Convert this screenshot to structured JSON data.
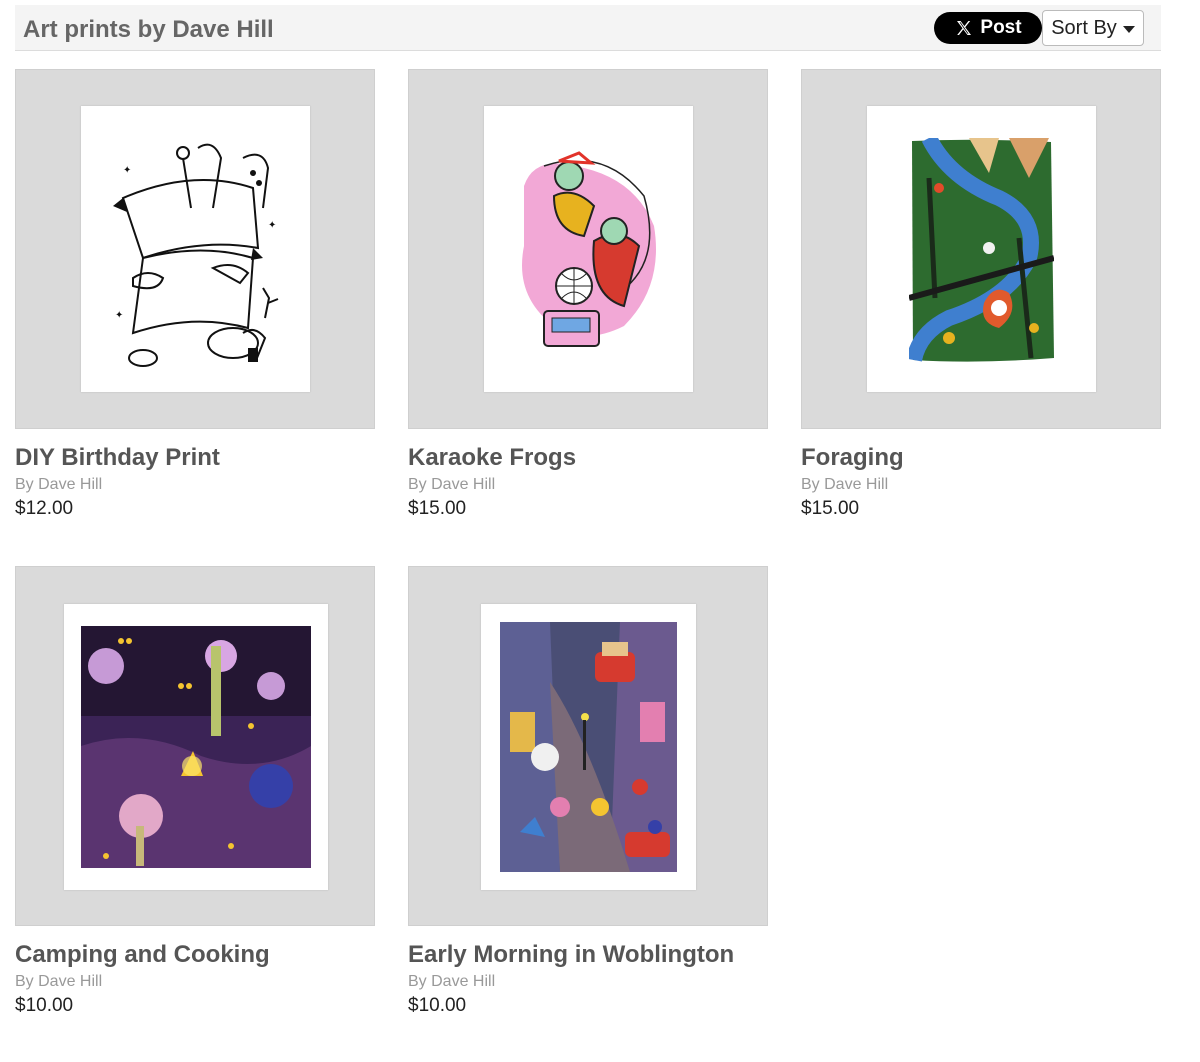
{
  "header": {
    "title": "Art prints by Dave Hill",
    "post_label": "Post",
    "sort_label": "Sort By"
  },
  "products": [
    {
      "name": "DIY Birthday Print",
      "by": "By Dave Hill",
      "price": "$12.00",
      "art_icon": "line-art-animals-banner"
    },
    {
      "name": "Karaoke Frogs",
      "by": "By Dave Hill",
      "price": "$15.00",
      "art_icon": "frogs-karaoke-illustration"
    },
    {
      "name": "Foraging",
      "by": "By Dave Hill",
      "price": "$15.00",
      "art_icon": "forest-river-illustration"
    },
    {
      "name": "Camping and Cooking",
      "by": "By Dave Hill",
      "price": "$10.00",
      "art_icon": "night-camp-illustration"
    },
    {
      "name": "Early Morning in Woblington",
      "by": "By Dave Hill",
      "price": "$10.00",
      "art_icon": "town-street-illustration"
    }
  ],
  "colors": {
    "frame_bg": "#dadada",
    "post_bg": "#000000",
    "title_color": "#666666"
  }
}
